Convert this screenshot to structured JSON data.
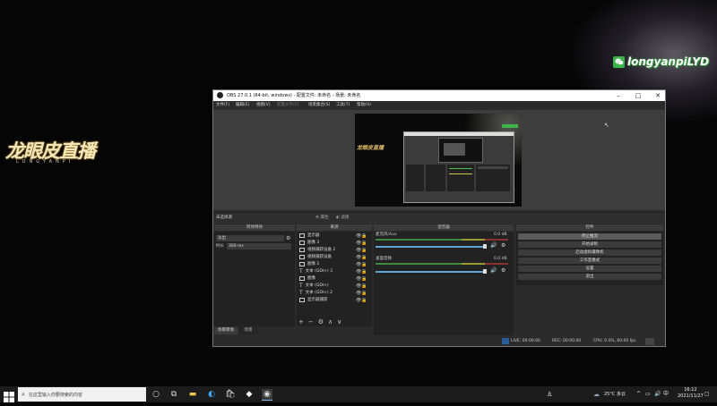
{
  "desktop": {
    "left_logo": "龙眼皮直播",
    "left_logo_sub": "LONGYANPI",
    "watermark": "longyanpiLYD"
  },
  "obs": {
    "title": "OBS 27.0.1 (64-bit, windows) - 配置文件: 未命名 - 场景: 未命名",
    "menu": [
      "文件(F)",
      "编辑(E)",
      "视图(V)",
      "配置文件(P)",
      "场景集合(S)",
      "工具(T)",
      "帮助(H)"
    ],
    "inner_logo": "龙眼皮直播",
    "no_source": "未选择源",
    "properties_label": "属性",
    "filters_label": "滤镜",
    "docks": {
      "transition": "转场特效",
      "sources": "来源",
      "mixer": "混音器",
      "controls": "控件"
    },
    "transition": {
      "type": "淡出",
      "duration_label": "时长",
      "duration": "300 ms"
    },
    "sources": [
      {
        "label": "显示器",
        "icon": "monitor-icon"
      },
      {
        "label": "图像 3",
        "icon": "image-icon"
      },
      {
        "label": "视频捕获设备 2",
        "icon": "camera-icon"
      },
      {
        "label": "视频捕获设备",
        "icon": "camera-icon"
      },
      {
        "label": "图像 2",
        "icon": "image-icon"
      },
      {
        "label": "文本 (GDI+) 3",
        "icon": "text-icon"
      },
      {
        "label": "图像",
        "icon": "image-icon"
      },
      {
        "label": "文本 (GDI+)",
        "icon": "text-icon"
      },
      {
        "label": "文本 (GDI+) 2",
        "icon": "text-icon"
      },
      {
        "label": "显示器捕获",
        "icon": "monitor-icon"
      }
    ],
    "mixer": [
      {
        "name": "麦克风/Aux",
        "level": "0.0 dB"
      },
      {
        "name": "桌面音频",
        "level": "0.0 dB"
      }
    ],
    "controls": [
      "停止推流",
      "开始录制",
      "启动虚拟摄像机",
      "工作室模式",
      "设置",
      "退出"
    ],
    "tabs": [
      "场景转场",
      "场景"
    ],
    "status": {
      "live": "LIVE: 00:00:00",
      "rec": "REC: 00:00:00",
      "cpu": "CPU: 0.4%, 60.00 fps"
    }
  },
  "taskbar": {
    "search_placeholder": "在这里输入你要搜索的内容",
    "weather": "25°C 多云",
    "time": "16:12",
    "date": "2021/11/27"
  }
}
